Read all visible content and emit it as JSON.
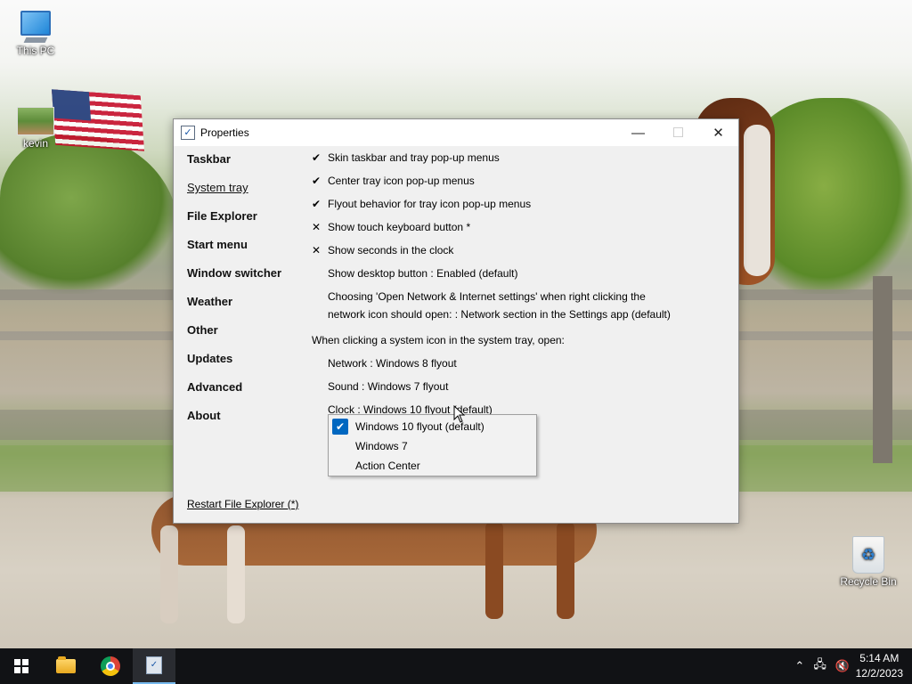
{
  "desktop": {
    "icons": [
      {
        "label": "This PC"
      },
      {
        "label": "kevin"
      },
      {
        "label": "Recycle Bin"
      }
    ]
  },
  "window": {
    "title": "Properties",
    "nav": [
      {
        "label": "Taskbar"
      },
      {
        "label": "System tray"
      },
      {
        "label": "File Explorer"
      },
      {
        "label": "Start menu"
      },
      {
        "label": "Window switcher"
      },
      {
        "label": "Weather"
      },
      {
        "label": "Other"
      },
      {
        "label": "Updates"
      },
      {
        "label": "Advanced"
      },
      {
        "label": "About"
      }
    ],
    "active_nav": "System tray",
    "options": [
      {
        "mark": "✔",
        "text": "Skin taskbar and tray pop-up menus"
      },
      {
        "mark": "✔",
        "text": "Center tray icon pop-up menus"
      },
      {
        "mark": "✔",
        "text": "Flyout behavior for tray icon pop-up menus"
      },
      {
        "mark": "✕",
        "text": "Show touch keyboard button *"
      },
      {
        "mark": "✕",
        "text": "Show seconds in the clock"
      },
      {
        "mark": "",
        "text": "Show desktop button : Enabled (default)"
      },
      {
        "mark": "",
        "text": "Choosing 'Open Network & Internet settings' when right clicking the network icon should open: : Network section in the Settings app (default)"
      }
    ],
    "tray_heading": "When clicking a system icon in the system tray, open:",
    "tray_options": [
      {
        "text": "Network : Windows 8 flyout"
      },
      {
        "text": "Sound : Windows 7 flyout"
      },
      {
        "text": "Clock : Windows 10 flyout (default)"
      }
    ],
    "restart_link": "Restart File Explorer (*)"
  },
  "dropdown": {
    "items": [
      {
        "label": "Windows 10 flyout (default)",
        "check": "✔"
      },
      {
        "label": "Windows 7",
        "check": ""
      },
      {
        "label": "Action Center",
        "check": ""
      }
    ]
  },
  "taskbar": {
    "time": "5:14 AM",
    "date": "12/2/2023"
  },
  "colors": {
    "accent": "#0067c0",
    "taskbar": "#111215",
    "window_bg": "#f0f0f0"
  }
}
